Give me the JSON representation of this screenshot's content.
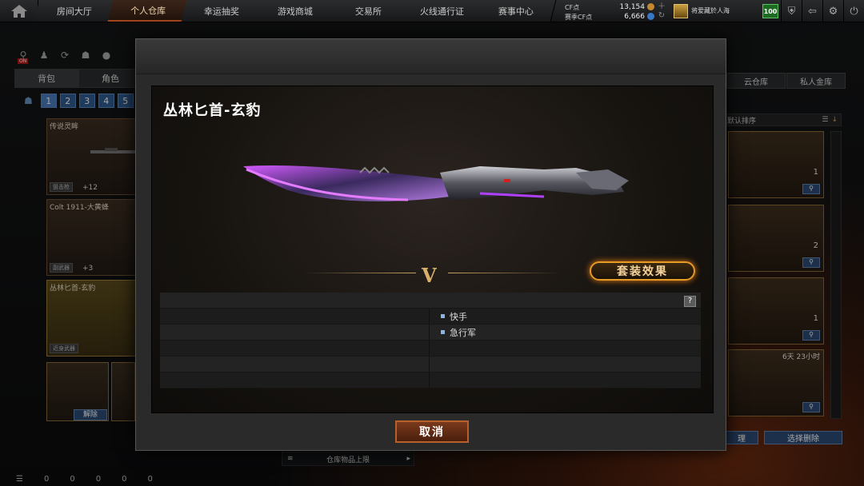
{
  "nav": {
    "tabs": [
      "房间大厅",
      "个人仓库",
      "幸运抽奖",
      "游戏商城",
      "交易所",
      "火线通行证",
      "赛事中心"
    ],
    "active_index": 1
  },
  "currency": {
    "cf_label": "CF点",
    "cf_value": "13,154",
    "match_label": "赛季CF点",
    "match_value": "6,666"
  },
  "rank": {
    "title": "将爱藏於人海"
  },
  "level": "100",
  "left_panel": {
    "tabs": [
      "背包",
      "角色"
    ],
    "pages": [
      "1",
      "2",
      "3",
      "4",
      "5"
    ],
    "on_badge": "ON",
    "cards": [
      {
        "name": "传说灵眸",
        "tag": "狙击枪",
        "plus": "+12"
      },
      {
        "name": "Colt 1911-大黄蜂",
        "tag": "副武器",
        "plus": "+3"
      },
      {
        "name": "丛林匕首-玄豹",
        "tag": "近身武器",
        "plus": ""
      }
    ],
    "release_label": "解除"
  },
  "right_panel": {
    "tabs": [
      "云仓库",
      "私人金库"
    ],
    "sort_label": "默认排序",
    "counts": [
      "1",
      "2",
      "1"
    ],
    "timer": "6天 23小时",
    "manage_label": "理",
    "batch_delete_label": "选择删除"
  },
  "capacity_label": "仓库物品上限",
  "status_counts": [
    "0",
    "0",
    "0",
    "0",
    "0"
  ],
  "modal": {
    "title": "丛林匕首-玄豹",
    "set_effect_label": "套装效果",
    "help_label": "?",
    "perks": [
      "快手",
      "急行军"
    ],
    "cancel_label": "取消"
  },
  "colors": {
    "accent_orange": "#e89a26",
    "button_blue": "#2d4a73",
    "active_tab": "#a3451b"
  }
}
